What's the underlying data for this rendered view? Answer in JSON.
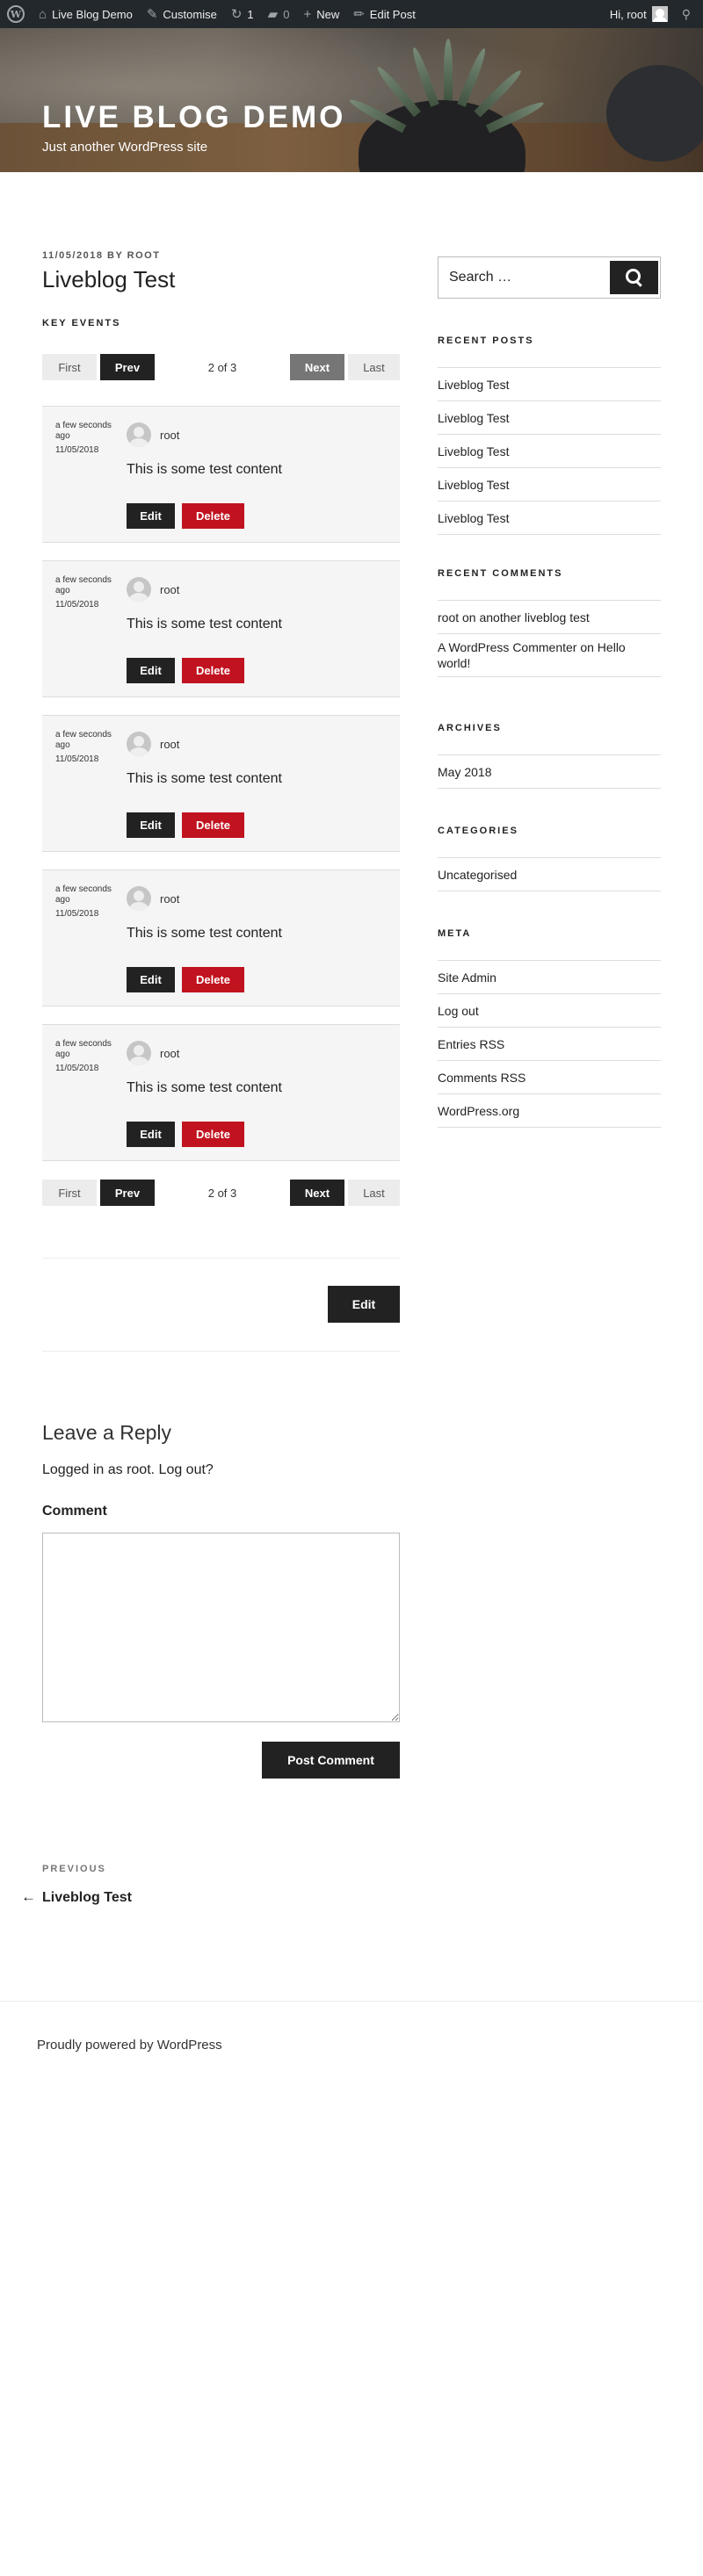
{
  "adminbar": {
    "site_name": "Live Blog Demo",
    "customise": "Customise",
    "updates_count": "1",
    "comments_count": "0",
    "new_label": "New",
    "edit_post": "Edit Post",
    "greeting": "Hi, root"
  },
  "header": {
    "site_title": "LIVE BLOG DEMO",
    "tagline": "Just another WordPress site"
  },
  "post": {
    "meta": "11/05/2018 BY ROOT",
    "title": "Liveblog Test",
    "key_events": "KEY EVENTS"
  },
  "pager": {
    "first": "First",
    "prev": "Prev",
    "count": "2 of 3",
    "next": "Next",
    "last": "Last"
  },
  "entries": [
    {
      "time": "a few seconds ago",
      "date": "11/05/2018",
      "author": "root",
      "content": "This is some test content",
      "edit": "Edit",
      "delete": "Delete"
    },
    {
      "time": "a few seconds ago",
      "date": "11/05/2018",
      "author": "root",
      "content": "This is some test content",
      "edit": "Edit",
      "delete": "Delete"
    },
    {
      "time": "a few seconds ago",
      "date": "11/05/2018",
      "author": "root",
      "content": "This is some test content",
      "edit": "Edit",
      "delete": "Delete"
    },
    {
      "time": "a few seconds ago",
      "date": "11/05/2018",
      "author": "root",
      "content": "This is some test content",
      "edit": "Edit",
      "delete": "Delete"
    },
    {
      "time": "a few seconds ago",
      "date": "11/05/2018",
      "author": "root",
      "content": "This is some test content",
      "edit": "Edit",
      "delete": "Delete"
    }
  ],
  "post_edit": "Edit",
  "reply": {
    "title": "Leave a Reply",
    "logged_in": "Logged in as root. Log out?",
    "comment_label": "Comment",
    "submit": "Post Comment"
  },
  "nav": {
    "previous_label": "PREVIOUS",
    "previous_title": "Liveblog Test"
  },
  "footer": {
    "powered": "Proudly powered by WordPress"
  },
  "sidebar": {
    "search_placeholder": "Search …",
    "recent_posts_title": "RECENT POSTS",
    "recent_posts": [
      "Liveblog Test",
      "Liveblog Test",
      "Liveblog Test",
      "Liveblog Test",
      "Liveblog Test"
    ],
    "recent_comments_title": "RECENT COMMENTS",
    "recent_comments": [
      "root on another liveblog test",
      "A WordPress Commenter on Hello world!"
    ],
    "archives_title": "ARCHIVES",
    "archives": [
      "May 2018"
    ],
    "categories_title": "CATEGORIES",
    "categories": [
      "Uncategorised"
    ],
    "meta_title": "META",
    "meta": [
      "Site Admin",
      "Log out",
      "Entries RSS",
      "Comments RSS",
      "WordPress.org"
    ]
  },
  "colors": {
    "adminbar_bg": "#23282d",
    "button_dark": "#222222",
    "button_delete": "#c1121f",
    "entry_bg": "#f5f5f5"
  }
}
